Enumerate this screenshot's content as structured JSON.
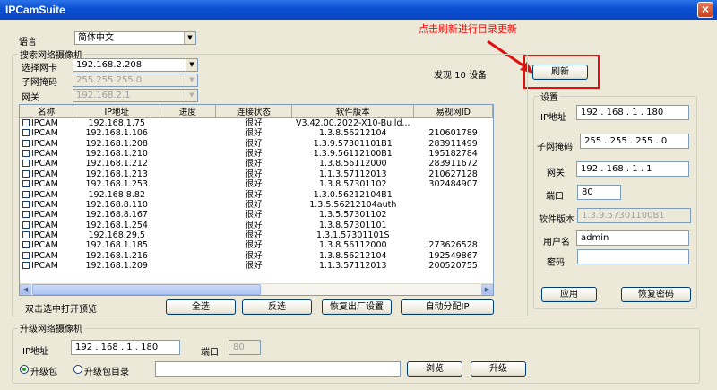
{
  "window": {
    "title": "IPCamSuite"
  },
  "language": {
    "label": "语言",
    "value": "简体中文"
  },
  "annotation": {
    "text": "点击刷新进行目录更新"
  },
  "search": {
    "group_title": "搜索网络摄像机",
    "nic_label": "选择网卡",
    "nic_value": "192.168.2.208",
    "mask_label": "子网掩码",
    "mask_value": "255.255.255.0",
    "gateway_label": "网关",
    "gateway_value": "192.168.2.1",
    "found_text": "发现 10 设备",
    "refresh_button": "刷新"
  },
  "table": {
    "columns": [
      "名称",
      "IP地址",
      "进度",
      "连接状态",
      "软件版本",
      "易视网ID"
    ],
    "rows": [
      [
        "IPCAM",
        "192.168.1.75",
        "",
        "很好",
        "V3.42.00.2022-X10-Build...",
        ""
      ],
      [
        "IPCAM",
        "192.168.1.106",
        "",
        "很好",
        "1.3.8.56212104",
        "210601789"
      ],
      [
        "IPCAM",
        "192.168.1.208",
        "",
        "很好",
        "1.3.9.57301101B1",
        "283911499"
      ],
      [
        "IPCAM",
        "192.168.1.210",
        "",
        "很好",
        "1.3.9.56112100B1",
        "195182784"
      ],
      [
        "IPCAM",
        "192.168.1.212",
        "",
        "很好",
        "1.3.8.56112000",
        "283911672"
      ],
      [
        "IPCAM",
        "192.168.1.213",
        "",
        "很好",
        "1.1.3.57112013",
        "210627128"
      ],
      [
        "IPCAM",
        "192.168.1.253",
        "",
        "很好",
        "1.3.8.57301102",
        "302484907"
      ],
      [
        "IPCAM",
        "192.168.8.82",
        "",
        "很好",
        "1.3.0.56212104B1",
        ""
      ],
      [
        "IPCAM",
        "192.168.8.110",
        "",
        "很好",
        "1.3.5.56212104auth",
        ""
      ],
      [
        "IPCAM",
        "192.168.8.167",
        "",
        "很好",
        "1.3.5.57301102",
        ""
      ],
      [
        "IPCAM",
        "192.168.1.254",
        "",
        "很好",
        "1.3.8.57301101",
        ""
      ],
      [
        "IPCAM",
        "192.168.29.5",
        "",
        "很好",
        "1.3.1.57301101S",
        ""
      ],
      [
        "IPCAM",
        "192.168.1.185",
        "",
        "很好",
        "1.3.8.56112000",
        "273626528"
      ],
      [
        "IPCAM",
        "192.168.1.216",
        "",
        "很好",
        "1.3.8.56212104",
        "192549867"
      ],
      [
        "IPCAM",
        "192.168.1.209",
        "",
        "很好",
        "1.1.3.57112013",
        "200520755"
      ]
    ]
  },
  "actions": {
    "preview_hint": "双击选中打开预览",
    "select_all": "全选",
    "invert": "反选",
    "factory_reset": "恢复出厂设置",
    "auto_ip": "自动分配IP"
  },
  "settings": {
    "group_title": "设置",
    "ip_label": "IP地址",
    "ip_value": "192 . 168 . 1 . 180",
    "mask_label": "子网掩码",
    "mask_value": "255 . 255 . 255 . 0",
    "gateway_label": "网关",
    "gateway_value": "192 . 168 . 1 . 1",
    "port_label": "端口",
    "port_value": "80",
    "version_label": "软件版本",
    "version_value": "1.3.9.57301100B1",
    "user_label": "用户名",
    "user_value": "admin",
    "password_label": "密码",
    "password_value": "",
    "apply_button": "应用",
    "restore_password_button": "恢复密码"
  },
  "upgrade": {
    "group_title": "升级网络摄像机",
    "ip_label": "IP地址",
    "ip_value": "192 . 168 . 1 . 180",
    "port_label": "端口",
    "port_value": "80",
    "radio_package": "升级包",
    "radio_dir": "升级包目录",
    "path_value": "",
    "browse_button": "浏览",
    "upgrade_button": "升级"
  },
  "colors": {
    "title_bar": "#0b4fd1",
    "annotation": "#ff0000",
    "dialog_bg": "#ece9d8"
  }
}
